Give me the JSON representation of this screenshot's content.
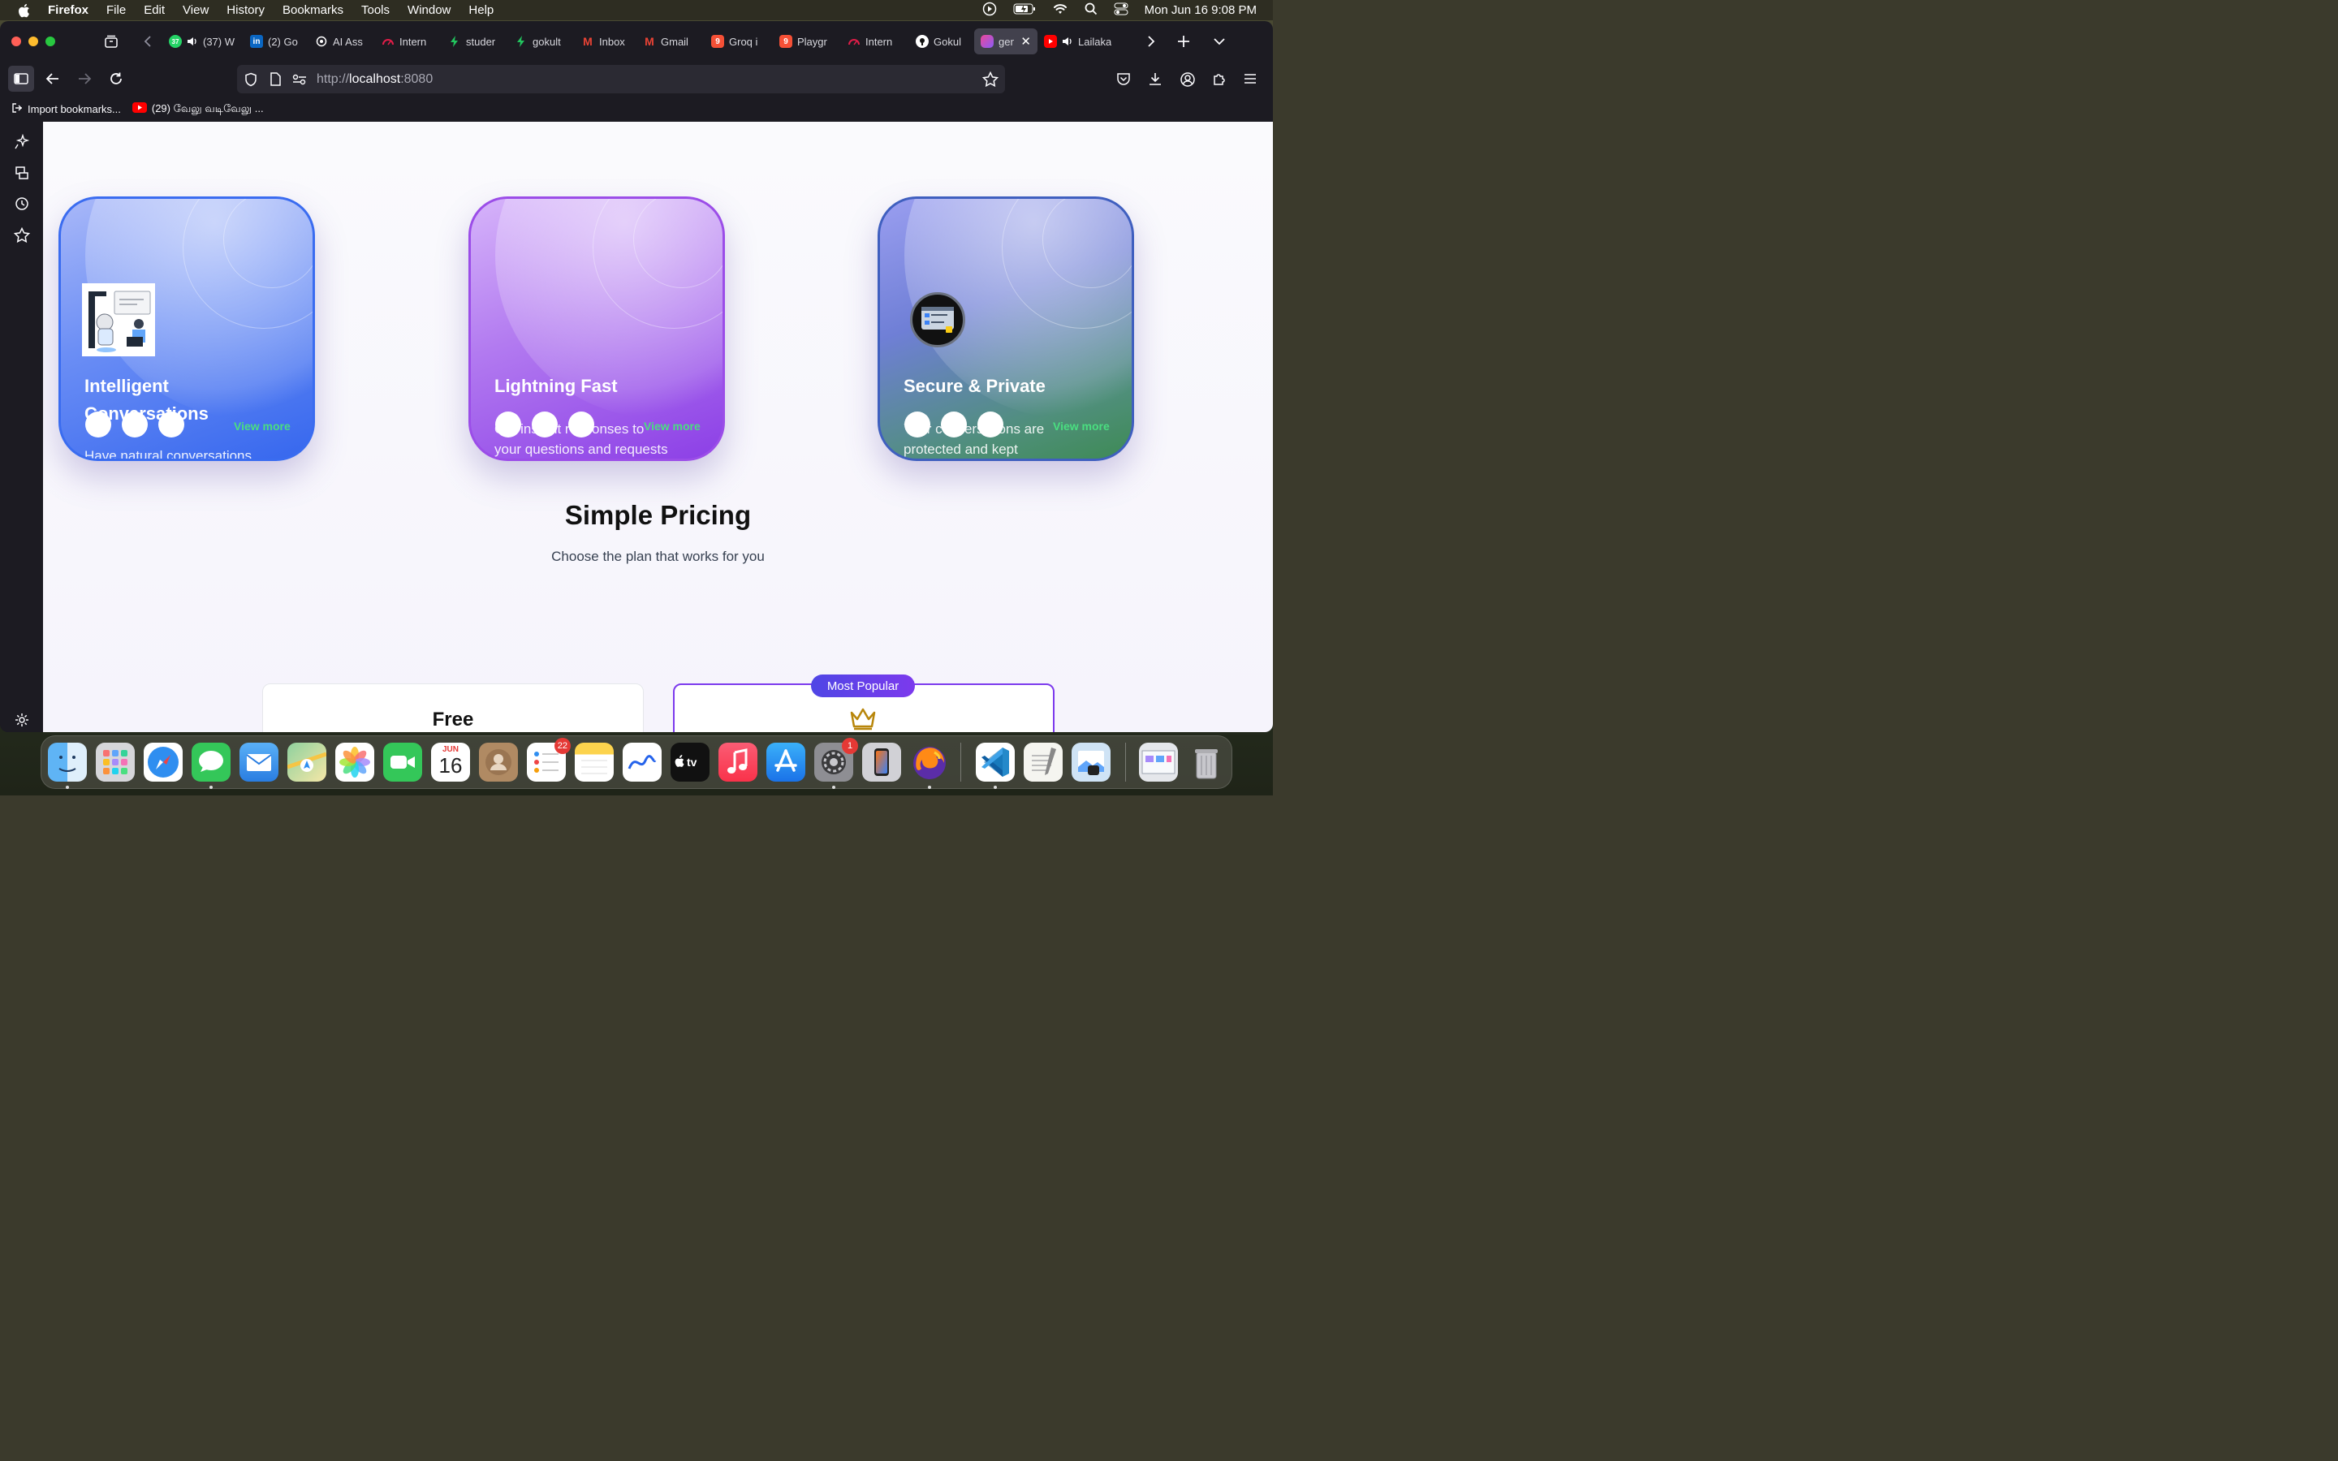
{
  "menubar": {
    "app_name": "Firefox",
    "menus": [
      "File",
      "Edit",
      "View",
      "History",
      "Bookmarks",
      "Tools",
      "Window",
      "Help"
    ],
    "datetime": "Mon Jun 16  9:08 PM"
  },
  "tabs": [
    {
      "label": "(37) W",
      "favicon": "whatsapp-icon",
      "color": "#25d366",
      "fav_text": "37"
    },
    {
      "label": "(2) Go",
      "favicon": "linkedin-icon",
      "color": "#0a66c2",
      "fav_text": "in"
    },
    {
      "label": "AI Ass",
      "favicon": "openai-icon",
      "color": "#ffffff",
      "fav_text": ""
    },
    {
      "label": "Intern",
      "favicon": "gauge-icon",
      "color": "#e11d48",
      "fav_text": ""
    },
    {
      "label": "studer",
      "favicon": "bolt-icon",
      "color": "#22c55e",
      "fav_text": ""
    },
    {
      "label": "gokult",
      "favicon": "bolt-icon",
      "color": "#22c55e",
      "fav_text": ""
    },
    {
      "label": "Inbox",
      "favicon": "gmail-icon",
      "color": "#ea4335",
      "fav_text": "M"
    },
    {
      "label": "Gmail",
      "favicon": "gmail-icon",
      "color": "#ea4335",
      "fav_text": "M"
    },
    {
      "label": "Groq i",
      "favicon": "groq-icon",
      "color": "#f55036",
      "fav_text": "9"
    },
    {
      "label": "Playgr",
      "favicon": "groq-icon",
      "color": "#f55036",
      "fav_text": "9"
    },
    {
      "label": "Intern",
      "favicon": "gauge-icon",
      "color": "#e11d48",
      "fav_text": ""
    },
    {
      "label": "Gokul",
      "favicon": "github-icon",
      "color": "#ffffff",
      "fav_text": ""
    },
    {
      "label": "gen",
      "favicon": "app-icon",
      "color": "#ec4899",
      "fav_text": "",
      "active": true
    },
    {
      "label": "Lailaka",
      "favicon": "youtube-icon",
      "color": "#ff0000",
      "fav_text": ""
    }
  ],
  "url": {
    "scheme": "http://",
    "host": "localhost",
    "port": ":8080"
  },
  "bookmarks": [
    {
      "label": "Import bookmarks..."
    },
    {
      "label": "(29) வேலு வடிவேலு ..."
    }
  ],
  "cards": [
    {
      "title": "Intelligent Conversations",
      "description": "Have natural conversations with our advanced AI assistant",
      "view_more": "View more",
      "gradient": [
        "#93a5f5",
        "#3b6cf0"
      ]
    },
    {
      "title": "Lightning Fast",
      "description": "Get instant responses to your questions and requests",
      "view_more": "View more",
      "gradient": [
        "#c79df5",
        "#9b4de8"
      ]
    },
    {
      "title": "Secure & Private",
      "description": "Your conversations are protected and kept confidential",
      "view_more": "View more",
      "gradient": [
        "#7f7ae6",
        "#4a9a6a"
      ]
    }
  ],
  "pricing": {
    "title": "Simple Pricing",
    "subtitle": "Choose the plan that works for you",
    "plans": [
      {
        "name": "Free"
      },
      {
        "name": "",
        "badge": "Most Popular"
      }
    ]
  },
  "dock": {
    "reminders_badge": "22",
    "settings_badge": "1",
    "calendar_month": "JUN",
    "calendar_day": "16"
  }
}
